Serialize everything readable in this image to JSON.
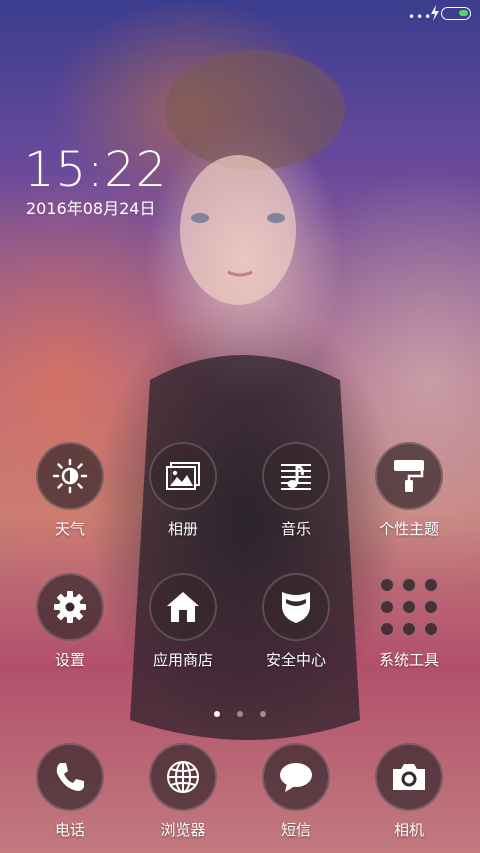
{
  "status_bar": {
    "dots": "•••",
    "icons": [
      "charging-icon",
      "battery-icon"
    ],
    "battery_color": "#4cd964"
  },
  "clock": {
    "time": "15:22",
    "date": "2016年08月24日"
  },
  "apps": [
    {
      "label": "天气",
      "icon": "weather-icon"
    },
    {
      "label": "相册",
      "icon": "gallery-icon"
    },
    {
      "label": "音乐",
      "icon": "music-icon"
    },
    {
      "label": "个性主题",
      "icon": "themes-icon"
    },
    {
      "label": "设置",
      "icon": "settings-icon"
    },
    {
      "label": "应用商店",
      "icon": "app-store-icon"
    },
    {
      "label": "安全中心",
      "icon": "security-icon"
    },
    {
      "label": "系统工具",
      "icon": "system-tools-folder-icon"
    }
  ],
  "page_indicator": {
    "count": 3,
    "active": 1
  },
  "dock": [
    {
      "label": "电话",
      "icon": "phone-icon"
    },
    {
      "label": "浏览器",
      "icon": "browser-icon"
    },
    {
      "label": "短信",
      "icon": "messages-icon"
    },
    {
      "label": "相机",
      "icon": "camera-icon"
    }
  ]
}
